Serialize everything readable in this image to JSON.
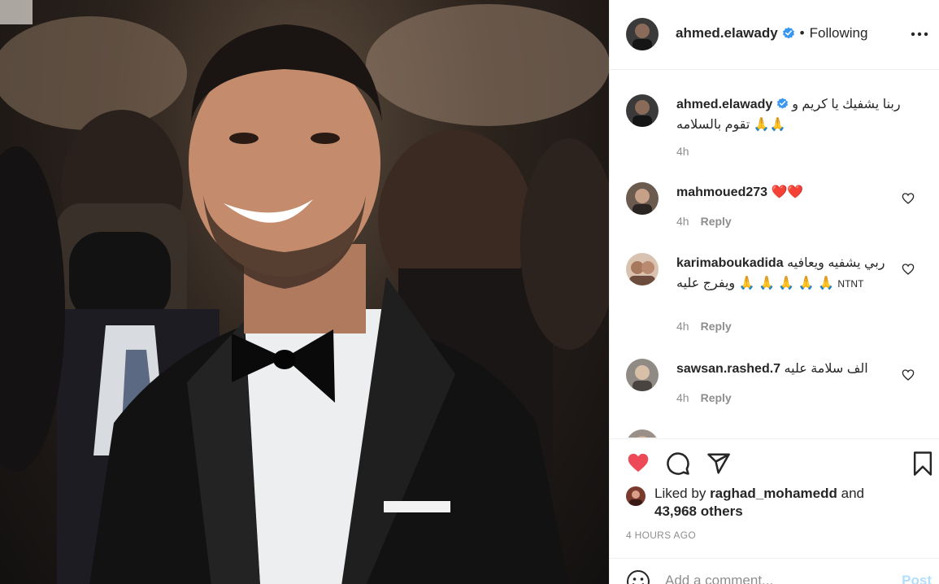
{
  "photo": {
    "icon": "post-photo"
  },
  "header": {
    "username": "ahmed.elawady",
    "verified_icon": "verified-badge-icon",
    "separator": "•",
    "follow_status": "Following",
    "more_icon": "more-options-icon"
  },
  "caption": {
    "username": "ahmed.elawady",
    "text": "ربنا يشفيك يا كريم و تقوم بالسلامه 🙏🙏",
    "time": "4h"
  },
  "comments": [
    {
      "username": "mahmoued273",
      "text": "❤️❤️",
      "time": "4h",
      "reply": "Reply"
    },
    {
      "username": "karimaboukadida",
      "text": "ربي يشفيه ويعافيه ويفرج عليه 🙏 🙏 🙏 🙏 🙏",
      "extra": "NTNT",
      "time": "4h",
      "reply": "Reply"
    },
    {
      "username": "sawsan.rashed.7",
      "text": "الف سلامة عليه",
      "time": "4h",
      "reply": "Reply"
    }
  ],
  "actions": {
    "like_icon": "heart-filled-icon",
    "comment_icon": "comment-icon",
    "share_icon": "share-icon",
    "save_icon": "bookmark-icon"
  },
  "likes": {
    "prefix": "Liked by",
    "user": "raghad_mohamedd",
    "and": "and",
    "count": "43,968 others"
  },
  "time_ago": "4 HOURS AGO",
  "add_comment": {
    "placeholder": "Add a comment...",
    "post_label": "Post"
  },
  "colors": {
    "like_red": "#ed4956",
    "verified_blue": "#3897f0",
    "muted": "#8e8e8e",
    "post_disabled": "#b2dffc"
  }
}
